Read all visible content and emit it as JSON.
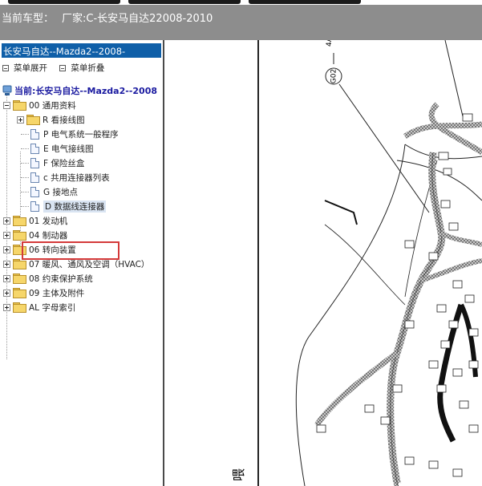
{
  "header": {
    "label": "当前车型：",
    "value": "厂家:C-长安马自达22008-2010"
  },
  "left_panel": {
    "title": "长安马自达--Mazda2--2008-",
    "toolbar": {
      "expand": "菜单展开",
      "collapse": "菜单折叠"
    },
    "root_label": "当前:长安马自达--Mazda2--2008",
    "tree": [
      {
        "label": "00 通用资料",
        "expanded": true
      },
      {
        "label": "R 看接线图"
      },
      {
        "label": "P 电气系统一般程序"
      },
      {
        "label": "E 电气接线图"
      },
      {
        "label": "F 保险丝盒"
      },
      {
        "label": "c 共用连接器列表"
      },
      {
        "label": "G 接地点"
      },
      {
        "label": "D 数据线连接器",
        "selected": true
      },
      {
        "label": "01 发动机"
      },
      {
        "label": "04 制动器"
      },
      {
        "label": "06 转向装置"
      },
      {
        "label": "07 暖风、通风及空调（HVAC）"
      },
      {
        "label": "08 约束保护系统"
      },
      {
        "label": "09 主体及附件"
      },
      {
        "label": "AL 字母索引"
      }
    ]
  },
  "diagram": {
    "connector_id": "G02",
    "arrow_label": "4A",
    "side_text": "喂",
    "colors": {
      "harness": "#9a9a9a",
      "line": "#222222",
      "title_bar": "#0f5fa8",
      "header_bg": "#8d8d8d",
      "highlight": "#d43a3a"
    }
  }
}
